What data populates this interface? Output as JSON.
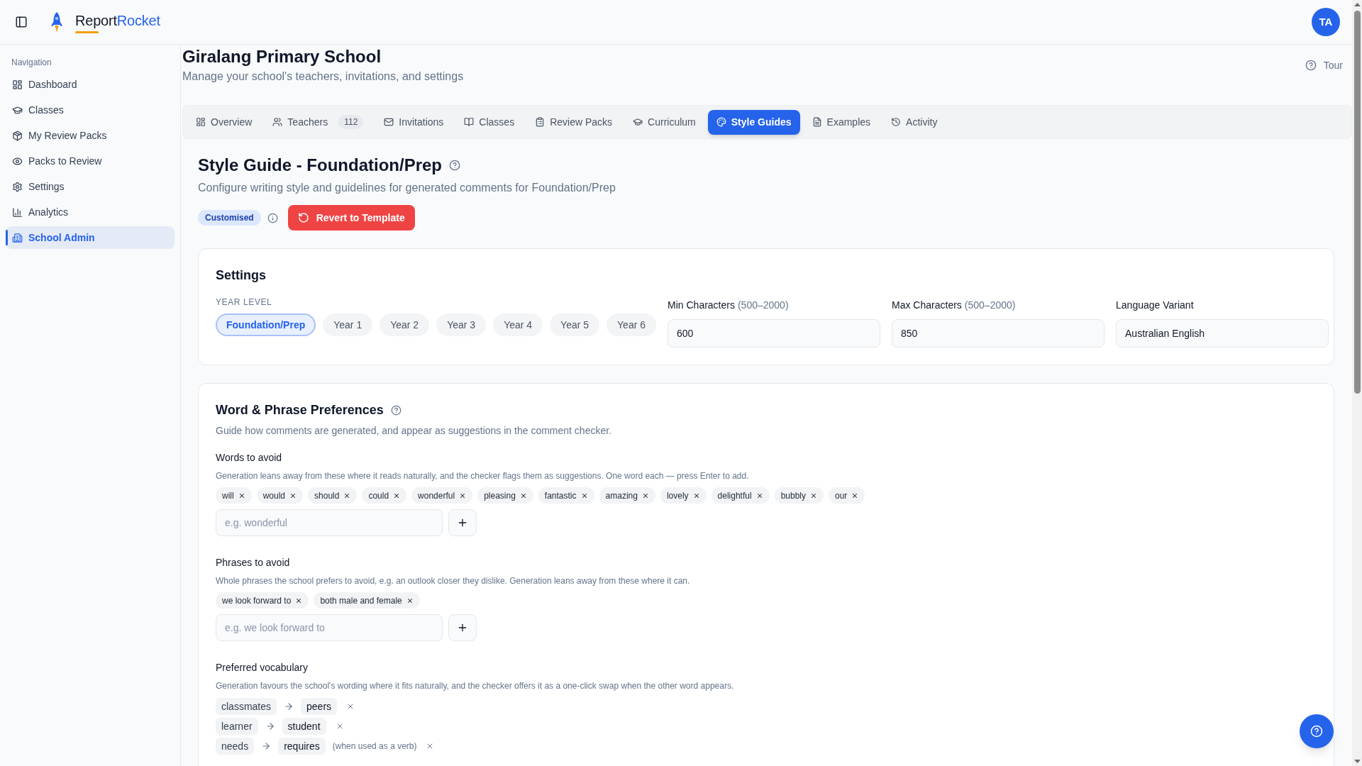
{
  "header": {
    "brand": {
      "first": "Report",
      "second": "Rocket"
    },
    "avatar": "TA"
  },
  "sidebar": {
    "heading": "Navigation",
    "items": [
      {
        "label": "Dashboard",
        "selected": false
      },
      {
        "label": "Classes",
        "selected": false
      },
      {
        "label": "My Review Packs",
        "selected": false
      },
      {
        "label": "Packs to Review",
        "selected": false
      },
      {
        "label": "Settings",
        "selected": false
      },
      {
        "label": "Analytics",
        "selected": false
      },
      {
        "label": "School Admin",
        "selected": true
      }
    ]
  },
  "page": {
    "title": "Giralang Primary School",
    "subtitle": "Manage your school's teachers, invitations, and settings",
    "tour": "Tour"
  },
  "tabs": [
    {
      "label": "Overview",
      "selected": false
    },
    {
      "label": "Teachers",
      "badge": "112",
      "selected": false
    },
    {
      "label": "Invitations",
      "selected": false
    },
    {
      "label": "Classes",
      "selected": false
    },
    {
      "label": "Review Packs",
      "selected": false
    },
    {
      "label": "Curriculum",
      "selected": false
    },
    {
      "label": "Style Guides",
      "selected": true
    },
    {
      "label": "Examples",
      "selected": false
    },
    {
      "label": "Activity",
      "selected": false
    }
  ],
  "style_guide": {
    "title": "Style Guide - Foundation/Prep",
    "subtitle": "Configure writing style and guidelines for generated comments for Foundation/Prep",
    "status": "Customised",
    "revert_button": "Revert to Template"
  },
  "settings": {
    "title": "Settings",
    "year_level_label": "YEAR LEVEL",
    "year_levels": [
      {
        "label": "Foundation/Prep",
        "selected": true
      },
      {
        "label": "Year 1",
        "selected": false
      },
      {
        "label": "Year 2",
        "selected": false
      },
      {
        "label": "Year 3",
        "selected": false
      },
      {
        "label": "Year 4",
        "selected": false
      },
      {
        "label": "Year 5",
        "selected": false
      },
      {
        "label": "Year 6",
        "selected": false
      }
    ],
    "fields": [
      {
        "label": "Min Characters",
        "hint": "(500–2000)",
        "value": "600"
      },
      {
        "label": "Max Characters",
        "hint": "(500–2000)",
        "value": "850"
      },
      {
        "label": "Language Variant",
        "value": "Australian English"
      }
    ]
  },
  "word_preferences": {
    "title": "Word & Phrase Preferences",
    "subtitle": "Guide how comments are generated, and appear as suggestions in the comment checker.",
    "sections": [
      {
        "kind": "tags",
        "title": "Words to avoid",
        "description": "Generation leans away from these where it reads naturally, and the checker flags them as suggestions. One word each — press Enter to add.",
        "tags": [
          "will",
          "would",
          "should",
          "could",
          "wonderful",
          "pleasing",
          "fantastic",
          "amazing",
          "lovely",
          "delightful",
          "bubbly",
          "our"
        ],
        "placeholder": "e.g. wonderful"
      },
      {
        "kind": "tags",
        "title": "Phrases to avoid",
        "description": "Whole phrases the school prefers to avoid, e.g. an outlook closer they dislike. Generation leans away from these where it can.",
        "tags": [
          "we look forward to",
          "both male and female"
        ],
        "placeholder": "e.g. we look forward to"
      },
      {
        "kind": "swaps",
        "title": "Preferred vocabulary",
        "description": "Generation favours the school's wording where it fits naturally, and the checker offers it as a one-click swap when the other word appears.",
        "swaps": [
          {
            "from": "classmates",
            "to": "peers"
          },
          {
            "from": "learner",
            "to": "student"
          },
          {
            "from": "needs",
            "to": "requires",
            "note": "(when used as a verb)"
          }
        ]
      }
    ]
  }
}
